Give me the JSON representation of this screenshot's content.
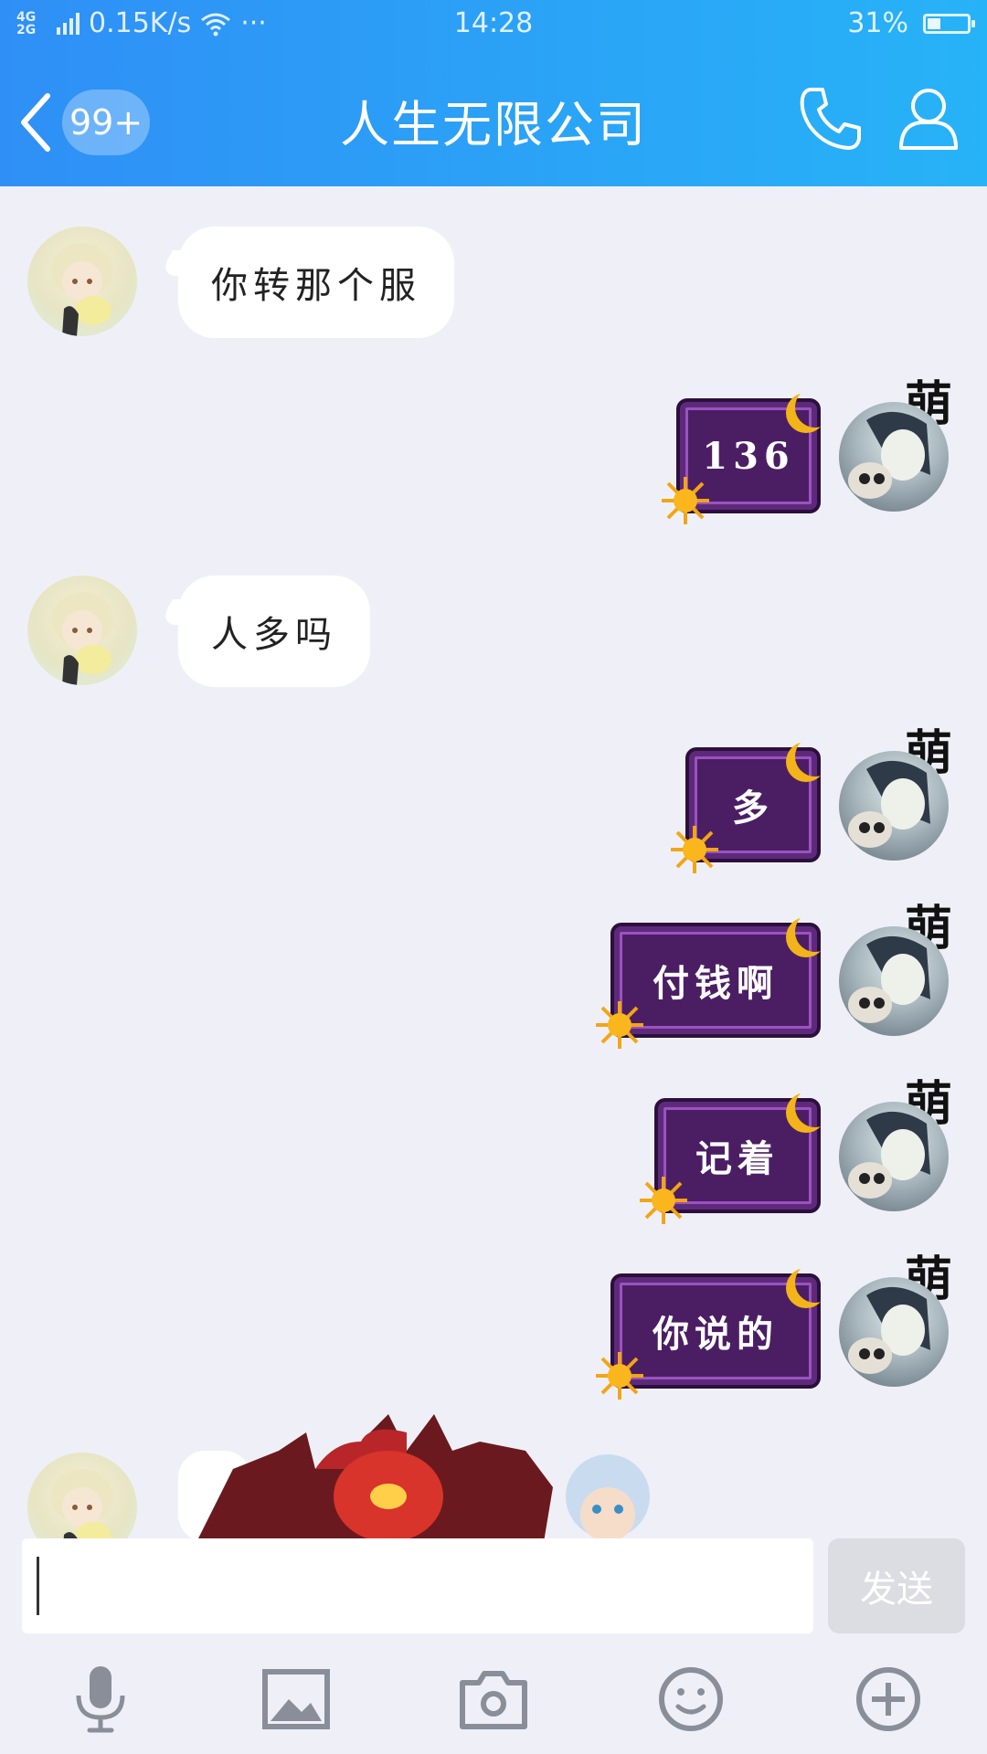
{
  "status_bar": {
    "network_type": "4G 2G",
    "speed": "0.15K/s",
    "more": "···",
    "time": "14:28",
    "battery_percent_text": "31%",
    "battery_level": 0.31
  },
  "header": {
    "unread_badge": "99+",
    "title": "人生无限公司"
  },
  "messages": [
    {
      "side": "left",
      "text": "你转那个服"
    },
    {
      "side": "right",
      "text": "136",
      "badge": "萌"
    },
    {
      "side": "left",
      "text": "人多吗"
    },
    {
      "side": "right",
      "text": "多",
      "badge": "萌"
    },
    {
      "side": "right",
      "text": "付钱啊",
      "badge": "萌"
    },
    {
      "side": "right",
      "text": "记着",
      "badge": "萌"
    },
    {
      "side": "right",
      "text": "你说的",
      "badge": "萌"
    },
    {
      "side": "left",
      "sticker": true
    }
  ],
  "composer": {
    "input_value": "",
    "send_label": "发送"
  },
  "toolbar": {
    "icons": [
      "microphone-icon",
      "image-icon",
      "camera-icon",
      "emoji-icon",
      "plus-icon"
    ]
  },
  "colors": {
    "header_start": "#2f8ff6",
    "header_end": "#27b3f7",
    "chat_bg": "#eff0f7",
    "purple_bubble": "#4b1e64",
    "toolbar_icon": "#8a8e99"
  }
}
